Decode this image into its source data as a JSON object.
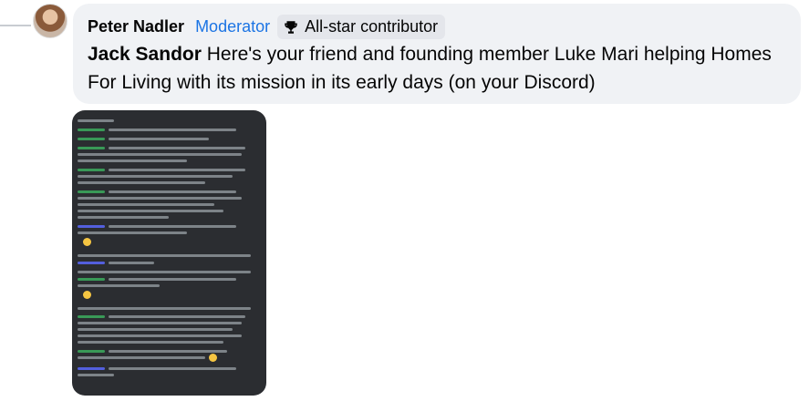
{
  "comment": {
    "author": "Peter Nadler",
    "role": "Moderator",
    "badge": {
      "icon": "trophy-icon",
      "label": "All-star contributor"
    },
    "mention": "Jack Sandor",
    "text": " Here's your friend and founding member Luke Mari helping Homes For Living with its mission in its early days (on your Discord)"
  },
  "attachment": {
    "type": "screenshot",
    "theme": "discord-dark",
    "background": "#2b2d31"
  },
  "colors": {
    "bubble": "#f0f2f5",
    "role": "#1b74e4",
    "text": "#050505"
  }
}
